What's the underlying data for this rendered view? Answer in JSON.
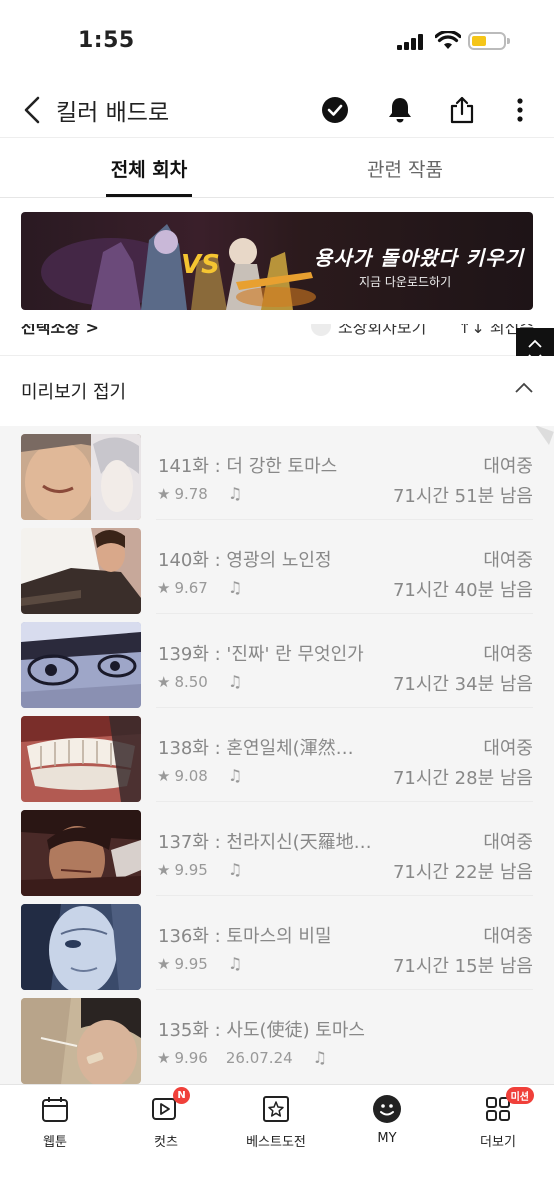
{
  "status_bar": {
    "time": "1:55"
  },
  "header": {
    "title": "킬러 배드로"
  },
  "tabs": [
    {
      "label": "전체 회차",
      "active": true
    },
    {
      "label": "관련 작품",
      "active": false
    }
  ],
  "ad": {
    "title": "용사가 돌아왔다 키우기",
    "subtitle": "지금 다운로드하기",
    "vs": "VS"
  },
  "sort": {
    "left": "선택소장 >",
    "mid": "소장회차보기",
    "right": "↑↓ 최신순"
  },
  "preview": {
    "label": "미리보기 접기"
  },
  "episodes": [
    {
      "title": "141화 : 더 강한 토마스",
      "rating": "9.78",
      "date": "",
      "status": "대여중",
      "remaining": "71시간 51분 남음"
    },
    {
      "title": "140화 : 영광의 노인정",
      "rating": "9.67",
      "date": "",
      "status": "대여중",
      "remaining": "71시간 40분 남음"
    },
    {
      "title": "139화 : '진짜' 란 무엇인가",
      "rating": "8.50",
      "date": "",
      "status": "대여중",
      "remaining": "71시간 34분 남음"
    },
    {
      "title": "138화 :  혼연일체(渾然…",
      "rating": "9.08",
      "date": "",
      "status": "대여중",
      "remaining": "71시간 28분 남음"
    },
    {
      "title": "137화 : 천라지신(天羅地…",
      "rating": "9.95",
      "date": "",
      "status": "대여중",
      "remaining": "71시간 22분 남음"
    },
    {
      "title": "136화 : 토마스의 비밀",
      "rating": "9.95",
      "date": "",
      "status": "대여중",
      "remaining": "71시간 15분 남음"
    },
    {
      "title": "135화 : 사도(使徒) 토마스",
      "rating": "9.96",
      "date": "26.07.24",
      "status": "",
      "remaining": ""
    }
  ],
  "bottom_nav": [
    {
      "label": "웹툰",
      "icon": "calendar-icon",
      "badge": ""
    },
    {
      "label": "컷츠",
      "icon": "play-icon",
      "badge": "N"
    },
    {
      "label": "베스트도전",
      "icon": "star-icon",
      "badge": ""
    },
    {
      "label": "MY",
      "icon": "smile-icon",
      "badge": ""
    },
    {
      "label": "더보기",
      "icon": "grid-icon",
      "badge": "미션"
    }
  ]
}
